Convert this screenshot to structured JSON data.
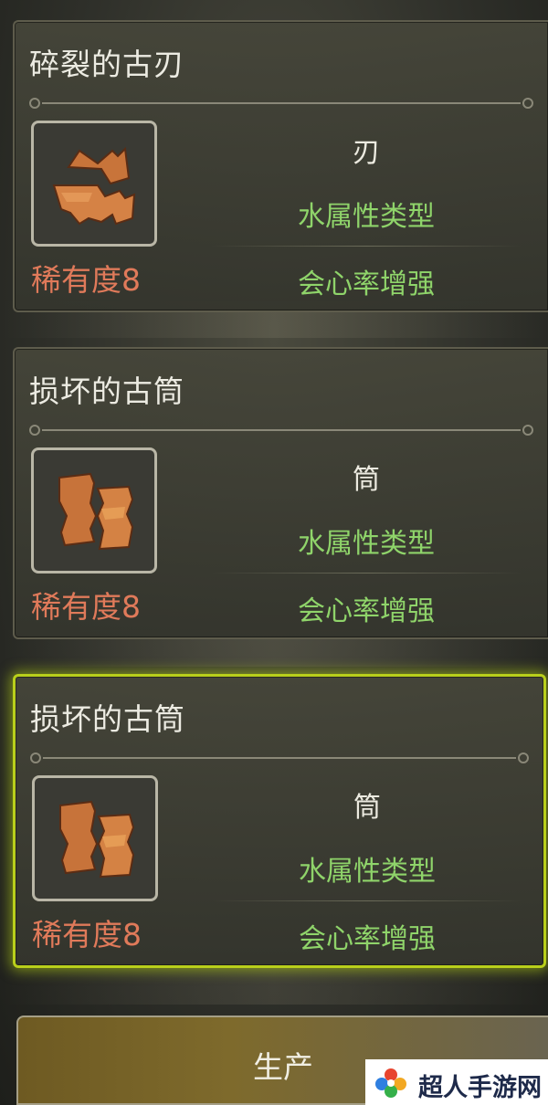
{
  "cards": [
    {
      "title": "碎裂的古刃",
      "type": "刃",
      "element": "水属性类型",
      "skill": "会心率增强",
      "rarity": "稀有度8",
      "icon": "broken-blade-icon",
      "selected": false
    },
    {
      "title": "损坏的古筒",
      "type": "筒",
      "element": "水属性类型",
      "skill": "会心率增强",
      "rarity": "稀有度8",
      "icon": "broken-cylinder-icon",
      "selected": false
    },
    {
      "title": "损坏的古筒",
      "type": "筒",
      "element": "水属性类型",
      "skill": "会心率增强",
      "rarity": "稀有度8",
      "icon": "broken-cylinder-icon",
      "selected": true
    }
  ],
  "produce_button": {
    "label": "生产"
  },
  "watermark": {
    "text": "超人手游网",
    "icon": "flower-logo"
  },
  "colors": {
    "rarity": "#e07a5a",
    "attribute_green": "#8fd46a",
    "selected_border": "#b9cf1b",
    "title": "#ecebe2"
  }
}
